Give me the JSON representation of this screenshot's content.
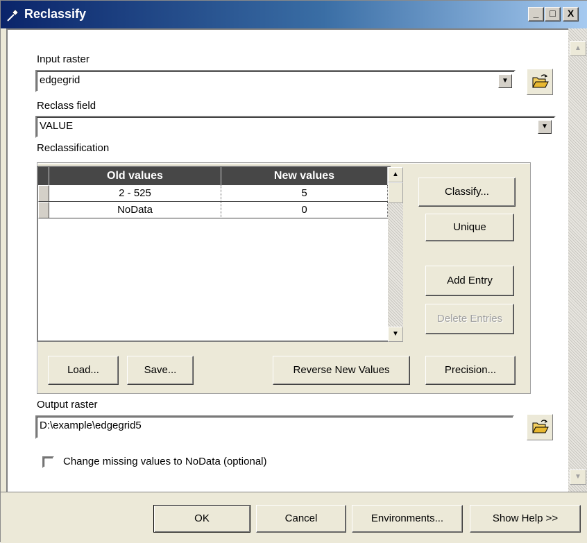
{
  "window": {
    "title": "Reclassify",
    "controls": {
      "minimize": "_",
      "maximize": "□",
      "close": "X"
    }
  },
  "input_raster": {
    "label": "Input raster",
    "value": "edgegrid"
  },
  "reclass_field": {
    "label": "Reclass field",
    "value": "VALUE"
  },
  "reclassification": {
    "label": "Reclassification",
    "columns": [
      "Old values",
      "New values"
    ],
    "rows": [
      {
        "old": "2 - 525",
        "new": "5"
      },
      {
        "old": "NoData",
        "new": "0"
      }
    ]
  },
  "side_buttons": {
    "classify": "Classify...",
    "unique": "Unique",
    "add_entry": "Add Entry",
    "delete_entries": "Delete Entries"
  },
  "grid_buttons": {
    "load": "Load...",
    "save": "Save...",
    "reverse": "Reverse New Values",
    "precision": "Precision..."
  },
  "output_raster": {
    "label": "Output raster",
    "value": "D:\\example\\edgegrid5"
  },
  "missing_values": {
    "label": "Change missing values to NoData (optional)",
    "checked": false
  },
  "footer": {
    "ok": "OK",
    "cancel": "Cancel",
    "environments": "Environments...",
    "show_help": "Show Help >>"
  },
  "icons": {
    "title": "hammer-icon",
    "browse": "open-folder-icon",
    "dropdown": "chevron-down-icon",
    "scroll_up": "arrow-up-icon",
    "scroll_down": "arrow-down-icon"
  }
}
